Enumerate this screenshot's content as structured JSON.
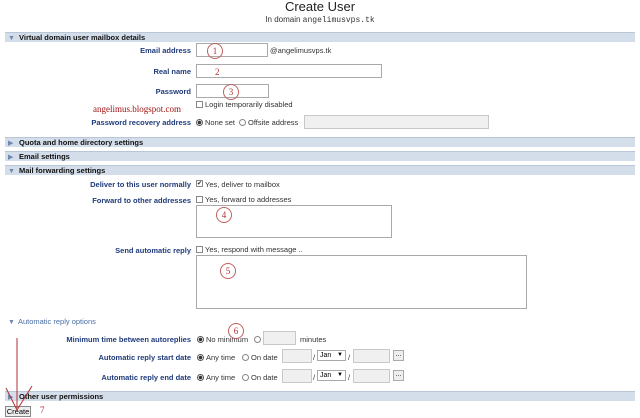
{
  "page": {
    "title": "Create User",
    "subtitle_prefix": "In domain",
    "domain": "angelimusvps.tk"
  },
  "sections": {
    "mailbox": "Virtual domain user mailbox details",
    "quota": "Quota and home directory settings",
    "email": "Email settings",
    "forwarding": "Mail forwarding settings",
    "permissions": "Other user permissions"
  },
  "mailbox": {
    "email_label": "Email address",
    "email_suffix": "@angelimusvps.tk",
    "realname_label": "Real name",
    "password_label": "Password",
    "login_disabled": "Login temporarily disabled",
    "recovery_label": "Password recovery address",
    "recovery_none": "None set",
    "recovery_offsite": "Offsite address"
  },
  "forwarding": {
    "deliver_label": "Deliver to this user normally",
    "deliver_option": "Yes, deliver to mailbox",
    "forward_label": "Forward to other addresses",
    "forward_option": "Yes, forward to addresses",
    "reply_label": "Send automatic reply",
    "reply_option": "Yes, respond with message .."
  },
  "autoreply": {
    "heading": "Automatic reply options",
    "min_time_label": "Minimum time between autoreplies",
    "no_minimum": "No minimum",
    "minutes": "minutes",
    "start_label": "Automatic reply start date",
    "end_label": "Automatic reply end date",
    "any_time": "Any time",
    "on_date": "On date",
    "slash": "/",
    "month": "Jan",
    "picker": "..."
  },
  "annotations": {
    "n1": "1",
    "n2": "2",
    "n3": "3",
    "n4": "4",
    "n5": "5",
    "n6": "6",
    "n7": "7",
    "watermark": "angelimus.blogspot.com"
  },
  "buttons": {
    "create": "Create"
  },
  "icons": {
    "section_expanded": "triangle-down-icon",
    "section_collapsed": "triangle-right-icon",
    "select_arrow": "caret-down-icon",
    "checkmark": "checkmark-icon"
  },
  "colors": {
    "section_bg": "#d4deea",
    "label": "#1f3b7a",
    "annotation": "#b03030"
  }
}
